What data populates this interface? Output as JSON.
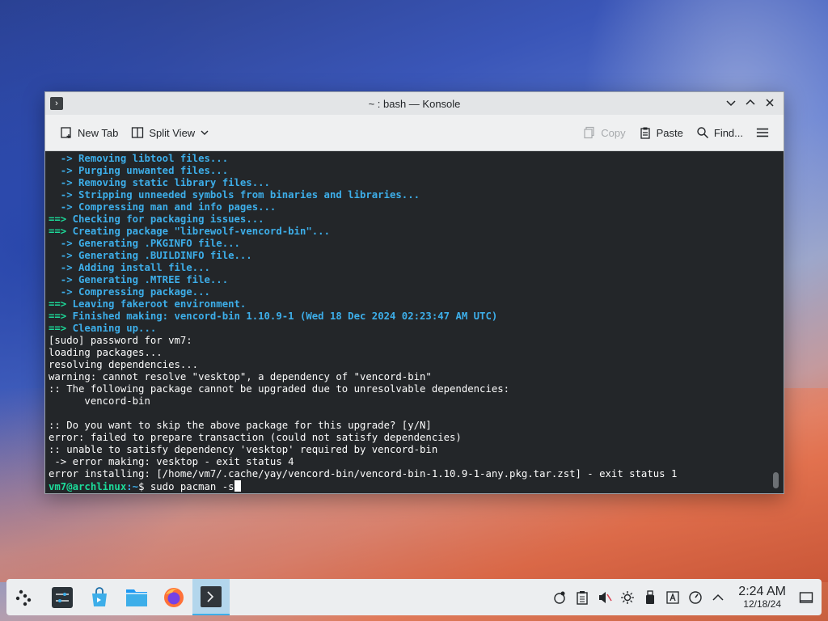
{
  "window": {
    "title": "~ : bash — Konsole"
  },
  "toolbar": {
    "new_tab": "New Tab",
    "split_view": "Split View",
    "copy": "Copy",
    "paste": "Paste",
    "find": "Find..."
  },
  "terminal": {
    "lines": [
      {
        "cls": "blue",
        "text": "  -> Removing libtool files..."
      },
      {
        "cls": "blue",
        "text": "  -> Purging unwanted files..."
      },
      {
        "cls": "blue",
        "text": "  -> Removing static library files..."
      },
      {
        "cls": "blue",
        "text": "  -> Stripping unneeded symbols from binaries and libraries..."
      },
      {
        "cls": "blue",
        "text": "  -> Compressing man and info pages..."
      },
      {
        "cls": "green",
        "text": "==> ",
        "rest": "Checking for packaging issues..."
      },
      {
        "cls": "green",
        "text": "==> ",
        "rest": "Creating package \"librewolf-vencord-bin\"..."
      },
      {
        "cls": "blue",
        "text": "  -> Generating .PKGINFO file..."
      },
      {
        "cls": "blue",
        "text": "  -> Generating .BUILDINFO file..."
      },
      {
        "cls": "blue",
        "text": "  -> Adding install file..."
      },
      {
        "cls": "blue",
        "text": "  -> Generating .MTREE file..."
      },
      {
        "cls": "blue",
        "text": "  -> Compressing package..."
      },
      {
        "cls": "green",
        "text": "==> ",
        "rest": "Leaving fakeroot environment."
      },
      {
        "cls": "green",
        "text": "==> ",
        "rest": "Finished making: vencord-bin 1.10.9-1 (Wed 18 Dec 2024 02:23:47 AM UTC)"
      },
      {
        "cls": "green",
        "text": "==> ",
        "rest": "Cleaning up..."
      },
      {
        "cls": "",
        "text": "[sudo] password for vm7:"
      },
      {
        "cls": "",
        "text": "loading packages..."
      },
      {
        "cls": "",
        "text": "resolving dependencies..."
      },
      {
        "cls": "",
        "text": "warning: cannot resolve \"vesktop\", a dependency of \"vencord-bin\""
      },
      {
        "cls": "",
        "text": ":: The following package cannot be upgraded due to unresolvable dependencies:"
      },
      {
        "cls": "",
        "text": "      vencord-bin"
      },
      {
        "cls": "",
        "text": ""
      },
      {
        "cls": "",
        "text": ":: Do you want to skip the above package for this upgrade? [y/N]"
      },
      {
        "cls": "",
        "text": "error: failed to prepare transaction (could not satisfy dependencies)"
      },
      {
        "cls": "",
        "text": ":: unable to satisfy dependency 'vesktop' required by vencord-bin"
      },
      {
        "cls": "",
        "text": " -> error making: vesktop - exit status 4"
      },
      {
        "cls": "",
        "text": "error installing: [/home/vm7/.cache/yay/vencord-bin/vencord-bin-1.10.9-1-any.pkg.tar.zst] - exit status 1"
      }
    ],
    "prompt_user": "vm7@archlinux",
    "prompt_path": ":~",
    "prompt_symbol": "$ ",
    "command": "sudo pacman -s"
  },
  "taskbar": {
    "time": "2:24 AM",
    "date": "12/18/24"
  }
}
